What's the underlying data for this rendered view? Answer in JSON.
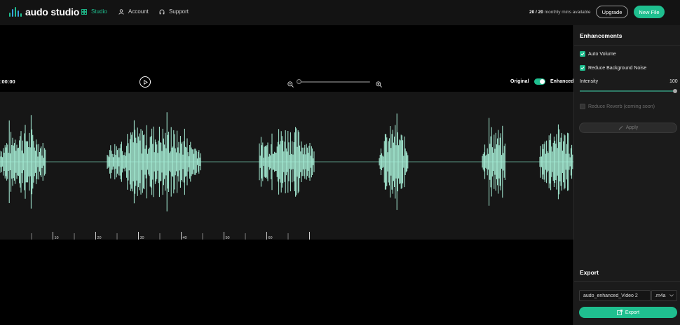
{
  "brand": {
    "name": "audo studio",
    "bar_colors": [
      "#1fbf8f",
      "#3aa0e0",
      "#1fbf8f",
      "#3aa0e0",
      "#1fbf8f"
    ]
  },
  "nav": {
    "items": [
      {
        "label": "Studio",
        "icon": "grid-icon",
        "active": true
      },
      {
        "label": "Account",
        "icon": "user-icon",
        "active": false
      },
      {
        "label": "Support",
        "icon": "headphones-icon",
        "active": false
      }
    ]
  },
  "usage": {
    "used": "20 / 20",
    "suffix": "monthly mins available"
  },
  "header_buttons": {
    "upgrade": "Upgrade",
    "new_file": "New File"
  },
  "player": {
    "timecode": ":00:00",
    "zoom_level": 0,
    "original_label": "Original",
    "enhanced_label": "Enhanced",
    "enhanced_on": true
  },
  "timeline": {
    "tick_labels": [
      "10",
      "20",
      "30",
      "40",
      "50",
      "60"
    ]
  },
  "enhancements": {
    "title": "Enhancements",
    "auto_volume": {
      "label": "Auto Volume",
      "checked": true
    },
    "reduce_noise": {
      "label": "Reduce Background Noise",
      "checked": true
    },
    "intensity": {
      "label": "Intensity",
      "value": "100",
      "fraction": 1.0
    },
    "reduce_reverb": {
      "label": "Reduce Reverb (coming soon)",
      "checked": false,
      "disabled": true
    },
    "apply_label": "Apply"
  },
  "export": {
    "title": "Export",
    "filename": "audo_enhanced_Video 2",
    "format": ".m4a",
    "button_label": "Export"
  },
  "colors": {
    "accent": "#1fbf8f",
    "waveform": "#a8f0d8",
    "background": "#000000",
    "panel": "#1b1b1b"
  }
}
